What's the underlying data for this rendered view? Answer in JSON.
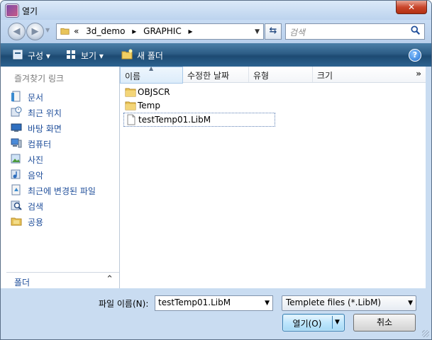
{
  "window": {
    "title": "열기",
    "close_glyph": "✕"
  },
  "addressbar": {
    "back_glyph": "◀",
    "forward_glyph": "▶",
    "path": [
      "«",
      "3d_demo",
      "▸",
      "GRAPHIC",
      "▸"
    ],
    "refresh_glyph": "⇆",
    "search_placeholder": "검색"
  },
  "toolbar": {
    "organize_label": "구성 ▾",
    "views_label": "보기 ▾",
    "new_folder_label": "새 폴더",
    "help_glyph": "?"
  },
  "sidebar": {
    "header": "즐겨찾기 링크",
    "items": [
      {
        "label": "문서",
        "icon": "documents-icon"
      },
      {
        "label": "최근 위치",
        "icon": "recent-places-icon"
      },
      {
        "label": "바탕 화면",
        "icon": "desktop-icon"
      },
      {
        "label": "컴퓨터",
        "icon": "computer-icon"
      },
      {
        "label": "사진",
        "icon": "pictures-icon"
      },
      {
        "label": "음악",
        "icon": "music-icon"
      },
      {
        "label": "최근에 변경된 파일",
        "icon": "recently-changed-icon"
      },
      {
        "label": "검색",
        "icon": "searches-icon"
      },
      {
        "label": "공용",
        "icon": "public-icon"
      }
    ],
    "folders_label": "폴더",
    "folders_chevron": "⌃"
  },
  "columns": {
    "name": "이름",
    "date": "수정한 날짜",
    "type": "유형",
    "size": "크기",
    "more": "»"
  },
  "files": [
    {
      "name": "OBJSCR",
      "kind": "folder"
    },
    {
      "name": "Temp",
      "kind": "folder"
    },
    {
      "name": "testTemp01.LibM",
      "kind": "file"
    }
  ],
  "bottom": {
    "filename_label": "파일 이름(N):",
    "filename_value": "testTemp01.LibM",
    "filter_value": "Templete files (*.LibM)",
    "open_label": "열기(O)",
    "cancel_label": "취소"
  },
  "colors": {
    "toolbar": "#2c5c85",
    "link": "#1f4e9a",
    "frame": "#c9dcf1"
  }
}
